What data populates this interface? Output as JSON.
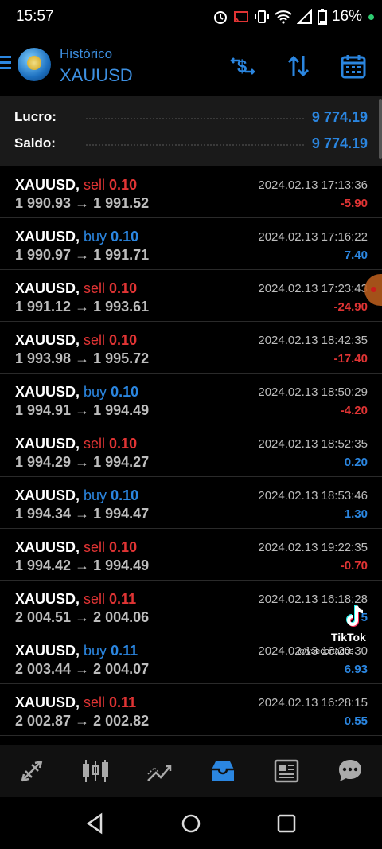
{
  "status_bar": {
    "time": "15:57",
    "battery": "16%"
  },
  "header": {
    "subtitle": "Histórico",
    "title": "XAUUSD"
  },
  "summary": {
    "profit_label": "Lucro:",
    "profit_value": "9 774.19",
    "balance_label": "Saldo:",
    "balance_value": "9 774.19"
  },
  "trades": [
    {
      "symbol": "XAUUSD,",
      "side": "sell",
      "volume": "0.10",
      "prices": "1 990.93 → 1 991.52",
      "datetime": "2024.02.13 17:13:36",
      "profit": "-5.90"
    },
    {
      "symbol": "XAUUSD,",
      "side": "buy",
      "volume": "0.10",
      "prices": "1 990.97 → 1 991.71",
      "datetime": "2024.02.13 17:16:22",
      "profit": "7.40"
    },
    {
      "symbol": "XAUUSD,",
      "side": "sell",
      "volume": "0.10",
      "prices": "1 991.12 → 1 993.61",
      "datetime": "2024.02.13 17:23:43",
      "profit": "-24.90"
    },
    {
      "symbol": "XAUUSD,",
      "side": "sell",
      "volume": "0.10",
      "prices": "1 993.98 → 1 995.72",
      "datetime": "2024.02.13 18:42:35",
      "profit": "-17.40"
    },
    {
      "symbol": "XAUUSD,",
      "side": "buy",
      "volume": "0.10",
      "prices": "1 994.91 → 1 994.49",
      "datetime": "2024.02.13 18:50:29",
      "profit": "-4.20"
    },
    {
      "symbol": "XAUUSD,",
      "side": "sell",
      "volume": "0.10",
      "prices": "1 994.29 → 1 994.27",
      "datetime": "2024.02.13 18:52:35",
      "profit": "0.20"
    },
    {
      "symbol": "XAUUSD,",
      "side": "buy",
      "volume": "0.10",
      "prices": "1 994.34 → 1 994.47",
      "datetime": "2024.02.13 18:53:46",
      "profit": "1.30"
    },
    {
      "symbol": "XAUUSD,",
      "side": "sell",
      "volume": "0.10",
      "prices": "1 994.42 → 1 994.49",
      "datetime": "2024.02.13 19:22:35",
      "profit": "-0.70"
    },
    {
      "symbol": "XAUUSD,",
      "side": "sell",
      "volume": "0.11",
      "prices": "2 004.51 → 2 004.06",
      "datetime": "2024.02.13 16:18:28",
      "profit": "5"
    },
    {
      "symbol": "XAUUSD,",
      "side": "buy",
      "volume": "0.11",
      "prices": "2 003.44 → 2 004.07",
      "datetime": "2024.02.13 16:20:30",
      "profit": "6.93"
    },
    {
      "symbol": "XAUUSD,",
      "side": "sell",
      "volume": "0.11",
      "prices": "2 002.87 → 2 002.82",
      "datetime": "2024.02.13 16:28:15",
      "profit": "0.55"
    }
  ],
  "watermark": {
    "name": "TikTok",
    "user": "@vsecortados"
  },
  "colors": {
    "accent": "#2b86e0",
    "sell": "#e03434",
    "buy": "#2b86e0"
  },
  "bottom_nav": {
    "items": [
      "quotes-icon",
      "chart-candles-icon",
      "trade-icon",
      "history-icon",
      "news-icon",
      "messages-icon"
    ],
    "active": "history-icon"
  },
  "system_nav": [
    "back-icon",
    "home-icon",
    "recents-icon"
  ]
}
